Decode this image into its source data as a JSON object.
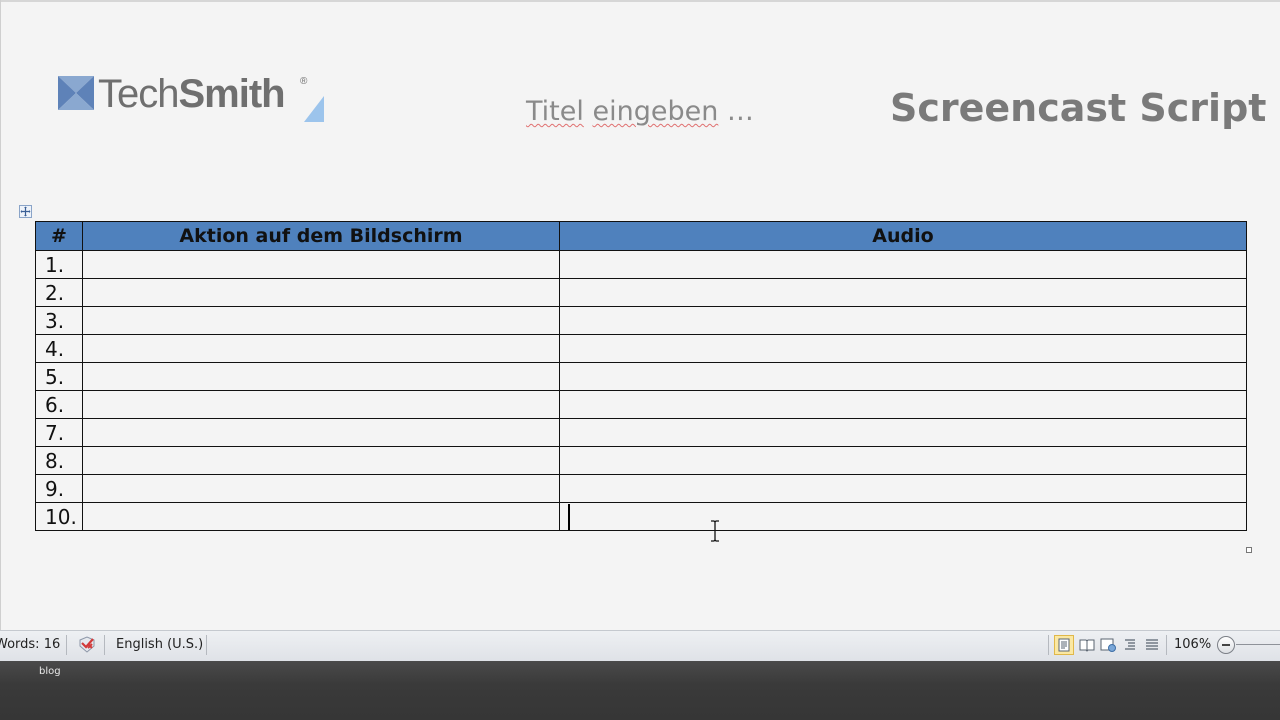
{
  "header": {
    "logo_text_light": "Tech",
    "logo_text_bold": "Smith",
    "logo_reg": "®",
    "title_placeholder_word1": "Titel",
    "title_placeholder_word2": "eingeben",
    "title_placeholder_rest": " …",
    "doc_title": "Screencast Script",
    "brand_color": "#4f81bd"
  },
  "table": {
    "headers": [
      "#",
      "Aktion auf dem Bildschirm",
      "Audio"
    ],
    "row_numbers": [
      "1.",
      "2.",
      "3.",
      "4.",
      "5.",
      "6.",
      "7.",
      "8.",
      "9.",
      "10."
    ],
    "header_color": "#4f81bd"
  },
  "statusbar": {
    "words": "Words: 16",
    "language": "English (U.S.)",
    "zoom": "106%"
  },
  "footer": {
    "label": "blog"
  },
  "icons": {
    "table_move": "table-move-handle-icon",
    "proofing": "proofing-check-icon",
    "view_print": "print-layout-icon",
    "view_reading": "full-screen-reading-icon",
    "view_web": "web-layout-icon",
    "view_outline": "outline-icon",
    "view_draft": "draft-icon",
    "zoom_out": "zoom-out-icon"
  }
}
